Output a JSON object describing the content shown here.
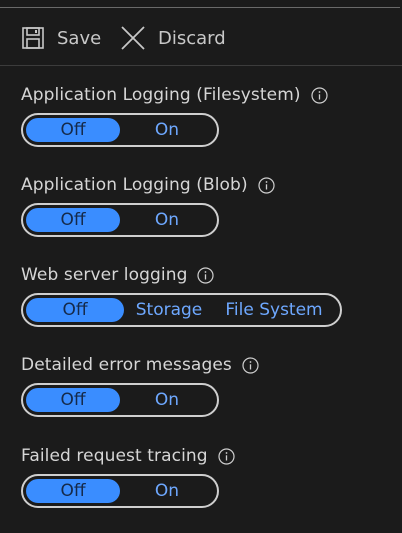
{
  "toolbar": {
    "save_label": "Save",
    "discard_label": "Discard",
    "save_icon": "floppy-disk-icon",
    "discard_icon": "close-icon"
  },
  "fields": [
    {
      "label": "Application Logging (Filesystem)",
      "options": [
        "Off",
        "On"
      ],
      "selected": "Off"
    },
    {
      "label": "Application Logging (Blob)",
      "options": [
        "Off",
        "On"
      ],
      "selected": "Off"
    },
    {
      "label": "Web server logging",
      "options": [
        "Off",
        "Storage",
        "File System"
      ],
      "selected": "Off"
    },
    {
      "label": "Detailed error messages",
      "options": [
        "Off",
        "On"
      ],
      "selected": "Off"
    },
    {
      "label": "Failed request tracing",
      "options": [
        "Off",
        "On"
      ],
      "selected": "Off"
    }
  ],
  "colors": {
    "background": "#1b1b1b",
    "accent": "#3a8dff",
    "option_text": "#6ea8ff",
    "label_text": "#d6d6d6"
  }
}
